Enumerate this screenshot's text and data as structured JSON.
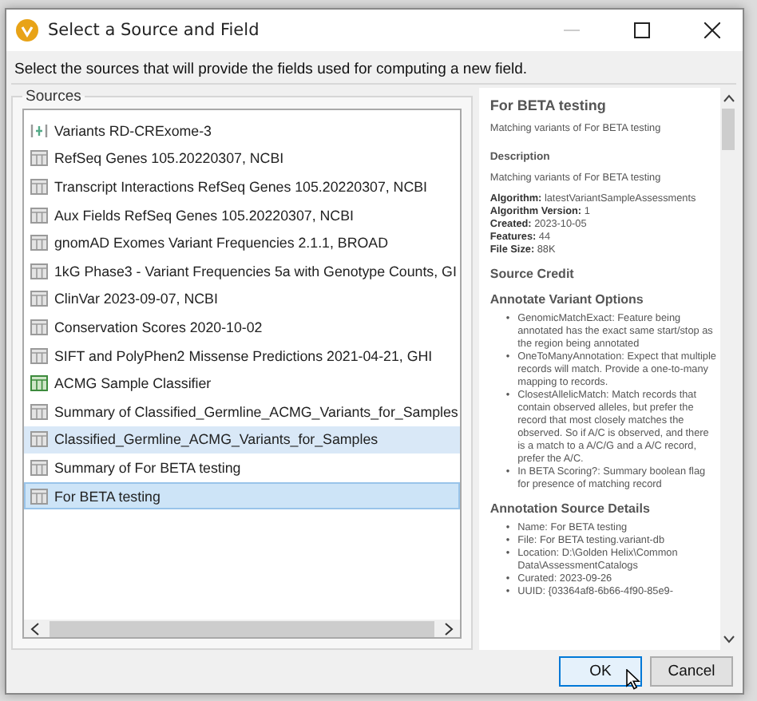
{
  "window": {
    "title": "Select a Source and Field"
  },
  "instruction": "Select the sources that will provide the fields used for computing a new field.",
  "sources": {
    "label": "Sources",
    "items": [
      {
        "name": "Variants RD-CRExome-3",
        "kind": "variants",
        "selected": false,
        "hovered": false
      },
      {
        "name": "RefSeq Genes 105.20220307, NCBI",
        "kind": "table",
        "selected": false,
        "hovered": false
      },
      {
        "name": "Transcript Interactions RefSeq Genes 105.20220307, NCBI",
        "kind": "table",
        "selected": false,
        "hovered": false
      },
      {
        "name": "Aux Fields RefSeq Genes 105.20220307, NCBI",
        "kind": "table",
        "selected": false,
        "hovered": false
      },
      {
        "name": "gnomAD Exomes Variant Frequencies 2.1.1, BROAD",
        "kind": "table",
        "selected": false,
        "hovered": false
      },
      {
        "name": "1kG Phase3 - Variant Frequencies 5a with Genotype Counts, GI",
        "kind": "table",
        "selected": false,
        "hovered": false
      },
      {
        "name": "ClinVar 2023-09-07, NCBI",
        "kind": "table",
        "selected": false,
        "hovered": false
      },
      {
        "name": "Conservation Scores 2020-10-02",
        "kind": "table",
        "selected": false,
        "hovered": false
      },
      {
        "name": "SIFT and PolyPhen2 Missense Predictions 2021-04-21, GHI",
        "kind": "table",
        "selected": false,
        "hovered": false
      },
      {
        "name": "ACMG Sample Classifier",
        "kind": "classifier",
        "selected": false,
        "hovered": false
      },
      {
        "name": "Summary of Classified_Germline_ACMG_Variants_for_Samples",
        "kind": "table",
        "selected": false,
        "hovered": false
      },
      {
        "name": "Classified_Germline_ACMG_Variants_for_Samples",
        "kind": "table",
        "selected": false,
        "hovered": true
      },
      {
        "name": "Summary of For BETA testing",
        "kind": "table",
        "selected": false,
        "hovered": false
      },
      {
        "name": "For BETA testing",
        "kind": "table",
        "selected": true,
        "hovered": false
      }
    ]
  },
  "details": {
    "title": "For BETA testing",
    "blocks": [
      {
        "kind": "paragraph",
        "text": "Matching variants of For BETA testing"
      },
      {
        "kind": "subheading",
        "text": "Description"
      },
      {
        "kind": "paragraph",
        "text": "Matching variants of For BETA testing"
      },
      {
        "kind": "fields",
        "items": [
          {
            "label": "Algorithm:",
            "value": "latestVariantSampleAssessments"
          },
          {
            "label": "Algorithm Version:",
            "value": "1"
          },
          {
            "label": "Created:",
            "value": "2023-10-05"
          },
          {
            "label": "Features:",
            "value": "44"
          },
          {
            "label": "File Size:",
            "value": "88K"
          }
        ]
      },
      {
        "kind": "heading",
        "text": "Source Credit"
      },
      {
        "kind": "heading",
        "text": "Annotate Variant Options"
      },
      {
        "kind": "bullets",
        "marker": "•",
        "items": [
          "GenomicMatchExact: Feature being annotated has the exact same start/stop as the region being annotated",
          "OneToManyAnnotation: Expect that multiple records will match. Provide a one-to-many mapping to records.",
          "ClosestAllelicMatch: Match records that contain observed alleles, but prefer the record that most closely matches the observed. So if A/C is observed, and there is a match to a A/C/G and a A/C record, prefer the A/C.",
          "In BETA Scoring?: Summary boolean flag for presence of matching record"
        ]
      },
      {
        "kind": "heading",
        "text": "Annotation Source Details"
      },
      {
        "kind": "bullets",
        "marker": "•",
        "items": [
          "Name: For BETA testing",
          "File: For BETA testing.variant-db",
          "Location: D:\\Golden Helix\\Common Data\\AssessmentCatalogs",
          "Curated: 2023-09-26",
          "UUID: {03364af8-6b66-4f90-85e9-"
        ]
      }
    ]
  },
  "buttons": [
    {
      "label": "OK",
      "default": true
    },
    {
      "label": "Cancel",
      "default": false
    }
  ]
}
